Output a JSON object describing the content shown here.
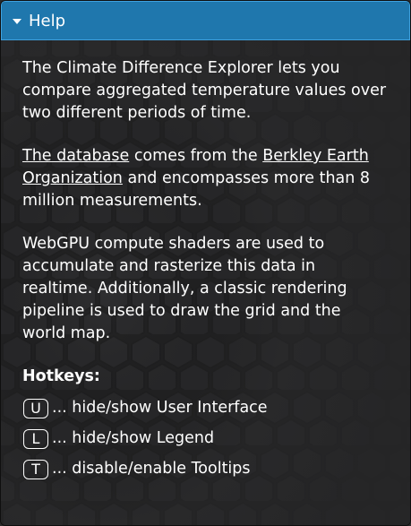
{
  "header": {
    "title": "Help",
    "caret_icon": "caret-down-icon"
  },
  "paragraphs": {
    "intro": "The Climate Difference Explorer lets you compare aggregated temperature values over two different periods of time.",
    "db_link": "The database",
    "db_mid": " comes from the ",
    "org_link": "Berkley Earth Organization",
    "db_end": " and encompasses more than 8 million measurements.",
    "webgpu": "WebGPU compute shaders are used to accumulate and rasterize this data in realtime. Additionally, a classic rendering pipeline is used to draw the grid and the world map."
  },
  "hotkeys": {
    "title": "Hotkeys:",
    "items": [
      {
        "key": "U",
        "text": "... hide/show User Interface"
      },
      {
        "key": "L",
        "text": "... hide/show Legend"
      },
      {
        "key": "T",
        "text": "... disable/enable Tooltips"
      }
    ]
  },
  "colors": {
    "panel_bg": "#252526",
    "header_bg": "#1f77ad",
    "header_border": "#3ea0dd",
    "text": "#ffffff"
  }
}
